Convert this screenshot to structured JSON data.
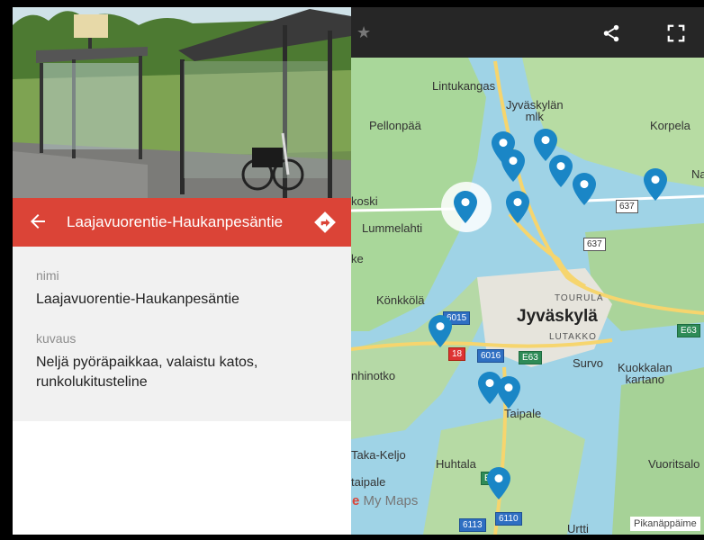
{
  "place": {
    "title": "Laajavuorentie-Haukanpesäntie",
    "fields": [
      {
        "label": "nimi",
        "value": "Laajavuorentie-Haukanpesäntie"
      },
      {
        "label": "kuvaus",
        "value": "Neljä pyöräpaikkaa, valaistu katos, runkolukitusteline"
      }
    ]
  },
  "map": {
    "labels": {
      "lintukangas": "Lintukangas",
      "jyvaskylan_mlk": "Jyväskylän\nmlk",
      "pellonpaa": "Pellonpää",
      "korpela": "Korpela",
      "koski": "koski",
      "lummelahti": "Lummelahti",
      "ke": "ke",
      "konkkola": "Könkkölä",
      "tourula": "TOURULA",
      "jyvaskyla": "Jyväskylä",
      "lutakko": "LUTAKKO",
      "nhinotko": "nhinotko",
      "survo": "Survo",
      "kuokkalan_kartano": "Kuokkalan\nkartano",
      "taipale": "Taipale",
      "taka_keljo": "Taka-Keljo",
      "taipale2": "taipale",
      "huhtala": "Huhtala",
      "vuoritsalo": "Vuoritsalo",
      "urtti": "Urtti",
      "na": "Na"
    },
    "road_shields": {
      "r637a": "637",
      "r637b": "637",
      "r6015": "6015",
      "r18": "18",
      "r6016": "6016",
      "e63a": "E63",
      "e63b": "E63",
      "r6113": "6113",
      "r6110": "6110",
      "e": "E"
    },
    "brand_prefix": "e",
    "brand_rest": " My Maps",
    "shortcut": "Pikanäppäime",
    "colors": {
      "pin": "#1a86c6",
      "header": "#db4437"
    },
    "icons": [
      "share-icon",
      "fullscreen-icon",
      "star-icon"
    ]
  }
}
